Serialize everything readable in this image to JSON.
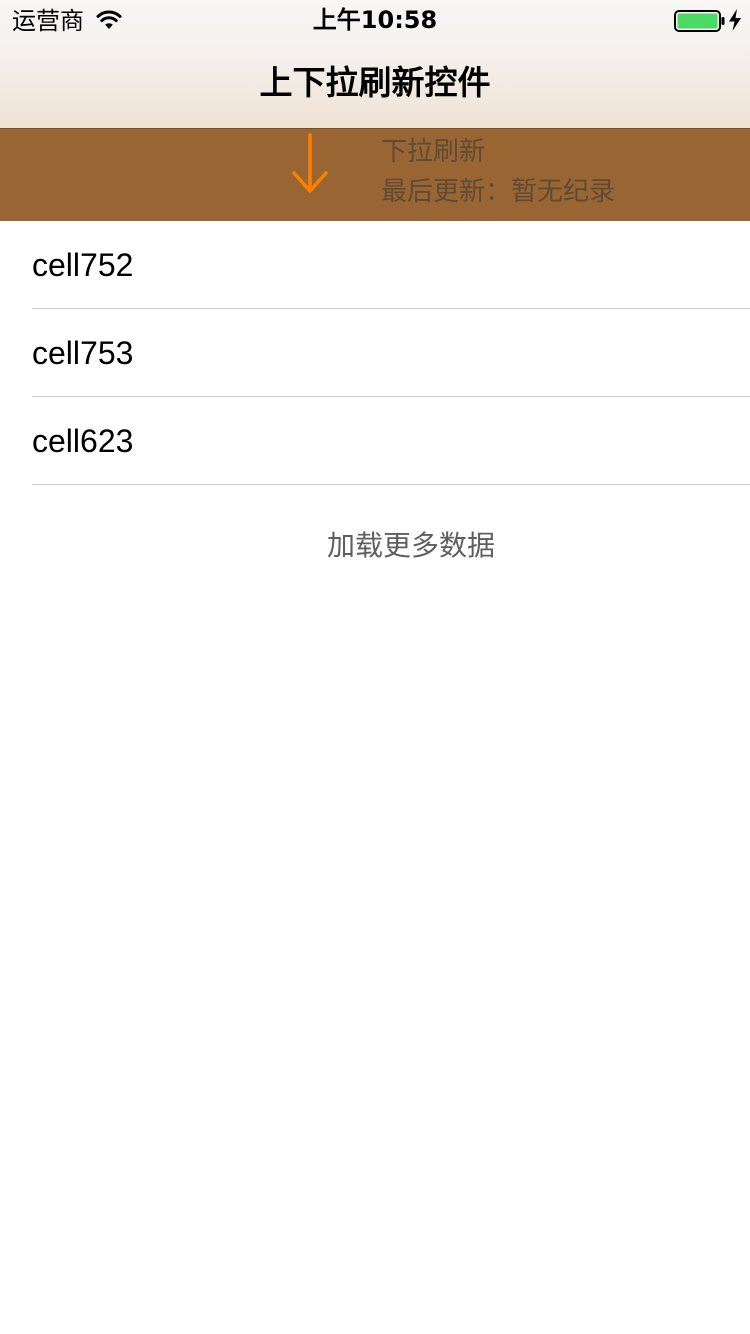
{
  "status_bar": {
    "carrier": "运营商",
    "time": "上午10:58",
    "wifi_icon": "wifi-icon",
    "battery_icon": "battery-full-icon",
    "charging_icon": "charging-bolt-icon",
    "battery_color": "#4cd964"
  },
  "nav": {
    "title": "上下拉刷新控件"
  },
  "refresh_header": {
    "state_text": "下拉刷新",
    "last_update_text": "最后更新：暂无纪录",
    "arrow_icon": "arrow-down-icon",
    "background_color": "#996633",
    "arrow_color": "#ff8000"
  },
  "table": {
    "rows": [
      {
        "label": "cell752"
      },
      {
        "label": "cell753"
      },
      {
        "label": "cell623"
      }
    ]
  },
  "footer": {
    "load_more_text": "加载更多数据"
  }
}
